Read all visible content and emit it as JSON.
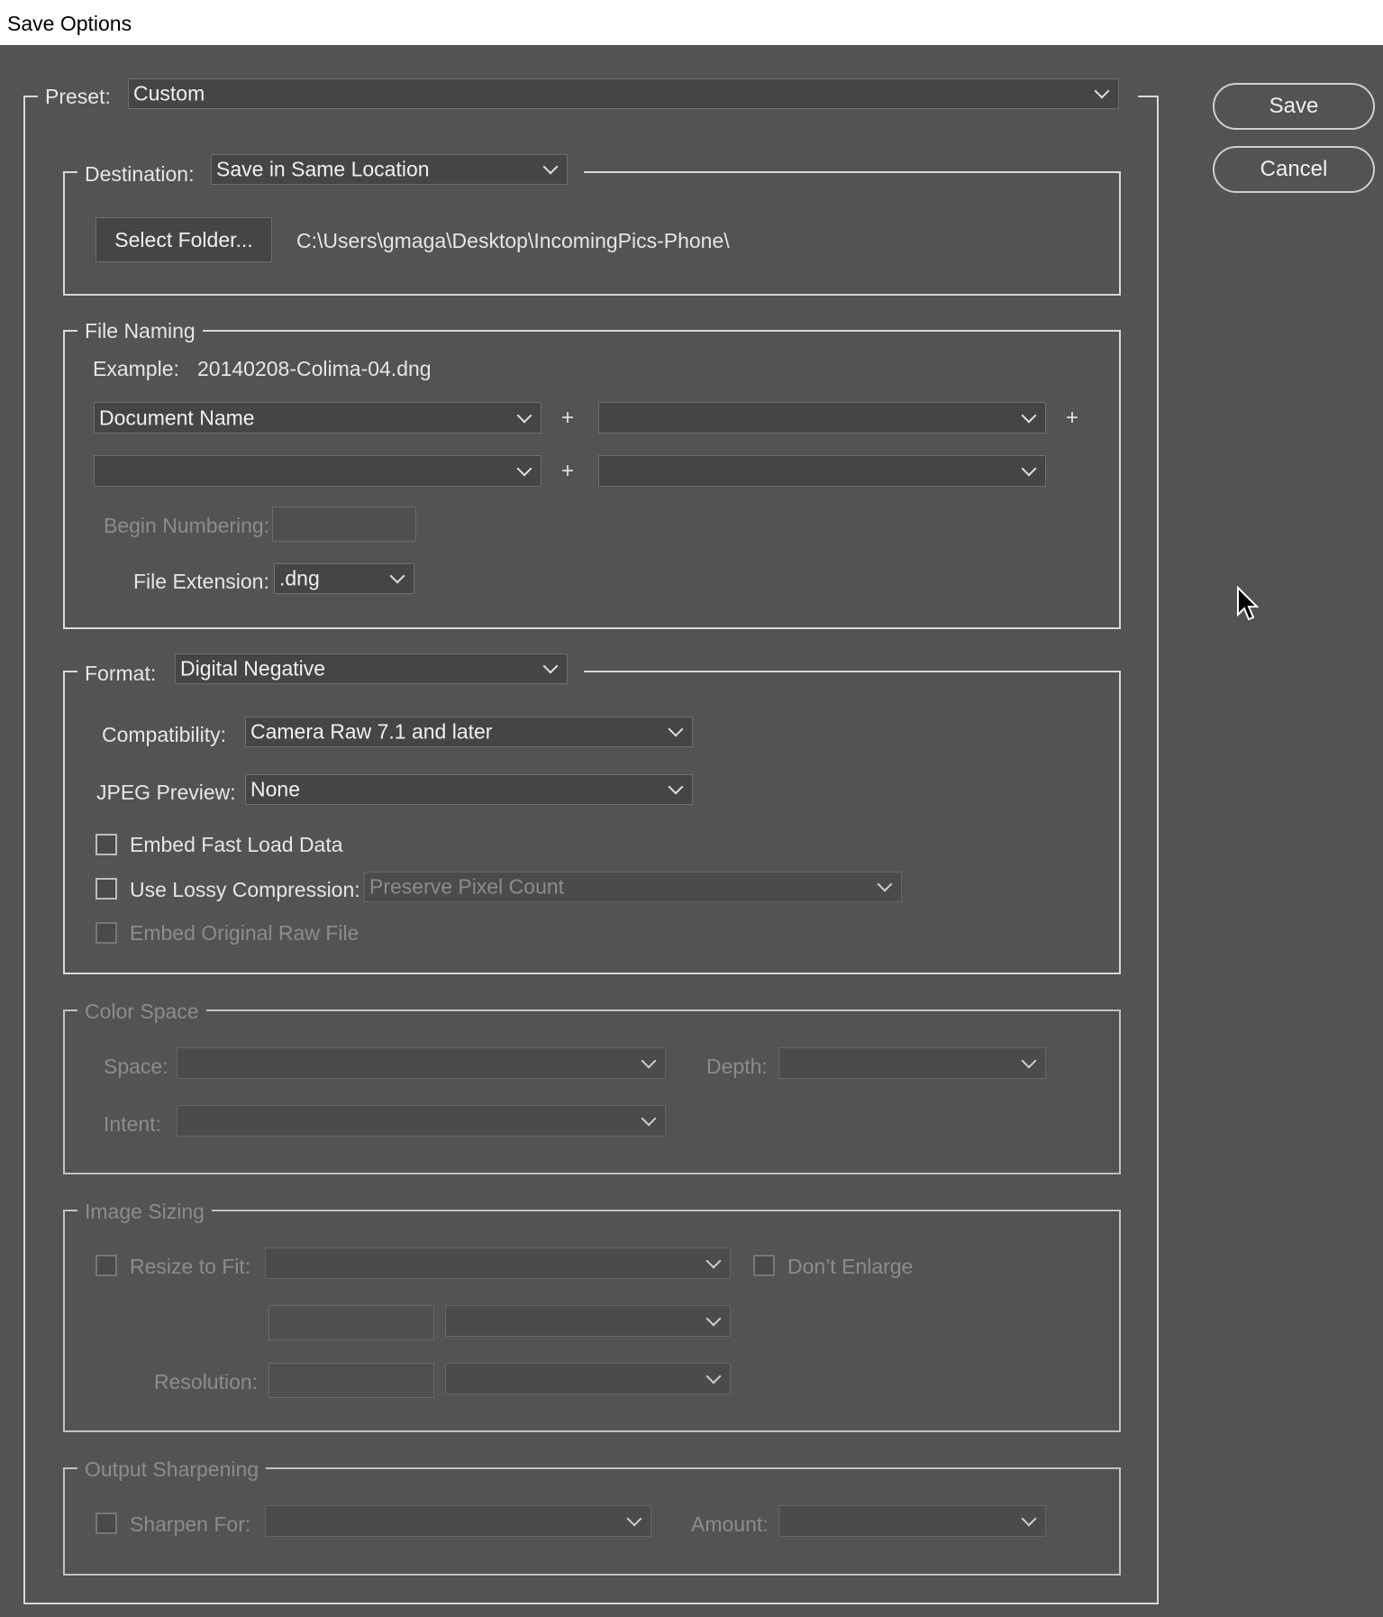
{
  "window": {
    "title": "Save Options"
  },
  "preset": {
    "label": "Preset:",
    "value": "Custom"
  },
  "buttons": {
    "save": "Save",
    "cancel": "Cancel"
  },
  "destination": {
    "label": "Destination:",
    "value": "Save in Same Location",
    "select_folder": "Select Folder...",
    "path": "C:\\Users\\gmaga\\Desktop\\IncomingPics-Phone\\"
  },
  "file_naming": {
    "title": "File Naming",
    "example_label": "Example:",
    "example_value": "20140208-Colima-04.dng",
    "field1": "Document Name",
    "field2": "",
    "field3": "",
    "field4": "",
    "plus": "+",
    "begin_numbering_label": "Begin Numbering:",
    "file_extension_label": "File Extension:",
    "file_extension_value": ".dng"
  },
  "format": {
    "label": "Format:",
    "value": "Digital Negative",
    "compatibility_label": "Compatibility:",
    "compatibility_value": "Camera Raw 7.1 and later",
    "jpeg_preview_label": "JPEG Preview:",
    "jpeg_preview_value": "None",
    "embed_fast_load": "Embed Fast Load Data",
    "use_lossy": "Use Lossy Compression:",
    "lossy_value": "Preserve Pixel Count",
    "embed_original": "Embed Original Raw File"
  },
  "color_space": {
    "title": "Color Space",
    "space_label": "Space:",
    "depth_label": "Depth:",
    "intent_label": "Intent:"
  },
  "image_sizing": {
    "title": "Image Sizing",
    "resize_label": "Resize to Fit:",
    "dont_enlarge": "Don’t Enlarge",
    "resolution_label": "Resolution:"
  },
  "output_sharpening": {
    "title": "Output Sharpening",
    "sharpen_label": "Sharpen For:",
    "amount_label": "Amount:"
  },
  "colors": {
    "background": "#535353",
    "titlebar": "#ffffff",
    "field": "#454545",
    "text": "#e6e6e6",
    "disabled_text": "#8c8c8c"
  }
}
